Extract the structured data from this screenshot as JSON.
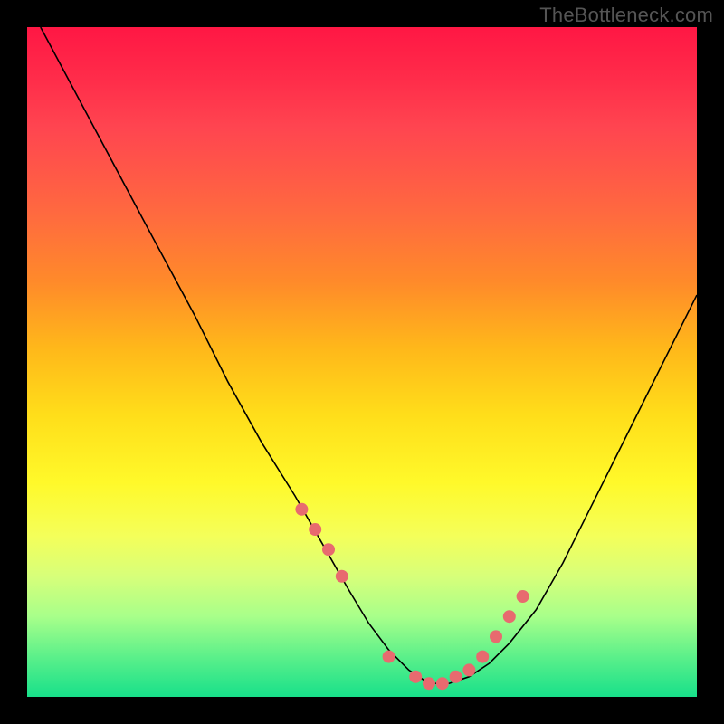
{
  "watermark": "TheBottleneck.com",
  "chart_data": {
    "type": "line",
    "title": "",
    "xlabel": "",
    "ylabel": "",
    "xlim": [
      0,
      100
    ],
    "ylim": [
      0,
      100
    ],
    "series": [
      {
        "name": "bottleneck-curve",
        "x": [
          2,
          10,
          18,
          25,
          30,
          35,
          40,
          44,
          48,
          51,
          54,
          57,
          60,
          63,
          66,
          69,
          72,
          76,
          80,
          84,
          88,
          92,
          96,
          100
        ],
        "y": [
          100,
          85,
          70,
          57,
          47,
          38,
          30,
          23,
          16,
          11,
          7,
          4,
          2,
          2,
          3,
          5,
          8,
          13,
          20,
          28,
          36,
          44,
          52,
          60
        ]
      }
    ],
    "markers": {
      "name": "highlight-points",
      "x": [
        41,
        43,
        45,
        47,
        54,
        58,
        60,
        62,
        64,
        66,
        68,
        70,
        72,
        74
      ],
      "y": [
        28,
        25,
        22,
        18,
        6,
        3,
        2,
        2,
        3,
        4,
        6,
        9,
        12,
        15
      ]
    },
    "gradient_stops": [
      {
        "pos": 0,
        "color": "#ff1744"
      },
      {
        "pos": 15,
        "color": "#ff4550"
      },
      {
        "pos": 38,
        "color": "#ff8a2a"
      },
      {
        "pos": 58,
        "color": "#ffde1a"
      },
      {
        "pos": 76,
        "color": "#f4ff5a"
      },
      {
        "pos": 94,
        "color": "#5cf08a"
      },
      {
        "pos": 100,
        "color": "#18e08a"
      }
    ]
  }
}
